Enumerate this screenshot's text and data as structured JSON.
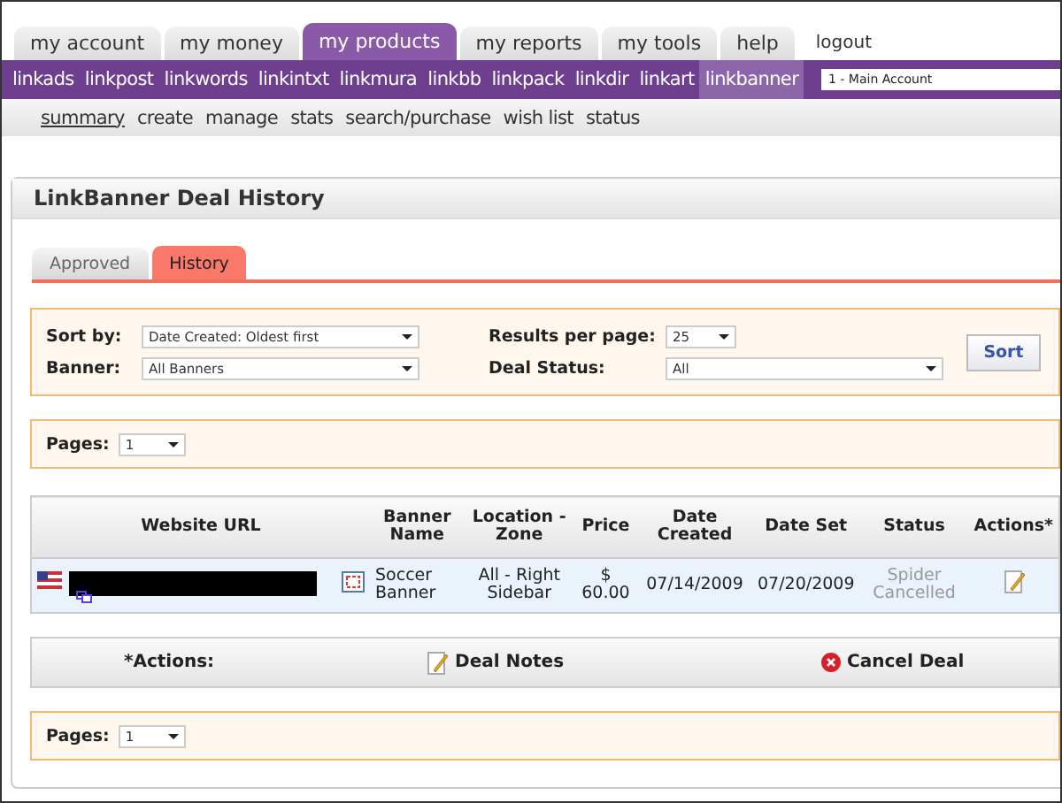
{
  "main_tabs": [
    {
      "label": "my account",
      "selected": false
    },
    {
      "label": "my money",
      "selected": false
    },
    {
      "label": "my products",
      "selected": true
    },
    {
      "label": "my reports",
      "selected": false
    },
    {
      "label": "my tools",
      "selected": false
    },
    {
      "label": "help",
      "selected": false
    }
  ],
  "logout": "logout",
  "product_nav": [
    {
      "label": "linkads",
      "selected": false
    },
    {
      "label": "linkpost",
      "selected": false
    },
    {
      "label": "linkwords",
      "selected": false
    },
    {
      "label": "linkintxt",
      "selected": false
    },
    {
      "label": "linkmura",
      "selected": false
    },
    {
      "label": "linkbb",
      "selected": false
    },
    {
      "label": "linkpack",
      "selected": false
    },
    {
      "label": "linkdir",
      "selected": false
    },
    {
      "label": "linkart",
      "selected": false
    },
    {
      "label": "linkbanner",
      "selected": true
    }
  ],
  "account_select": {
    "value": "1 - Main Account"
  },
  "sub_nav": [
    {
      "label": "summary",
      "selected": true
    },
    {
      "label": "create",
      "selected": false
    },
    {
      "label": "manage",
      "selected": false
    },
    {
      "label": "stats",
      "selected": false
    },
    {
      "label": "search/purchase",
      "selected": false
    },
    {
      "label": "wish list",
      "selected": false
    },
    {
      "label": "status",
      "selected": false
    }
  ],
  "panel": {
    "title": "LinkBanner Deal History",
    "tabs": [
      {
        "label": "Approved",
        "selected": false
      },
      {
        "label": "History",
        "selected": true
      }
    ],
    "filters": {
      "sort_by": {
        "label": "Sort by:",
        "value": "Date Created: Oldest first"
      },
      "results_per_page": {
        "label": "Results per page:",
        "value": "25"
      },
      "banner": {
        "label": "Banner:",
        "value": "All Banners"
      },
      "deal_status": {
        "label": "Deal Status:",
        "value": "All"
      },
      "sort_button": "Sort"
    },
    "pages_top": {
      "label": "Pages:",
      "value": "1"
    },
    "table": {
      "columns": [
        "Website URL",
        "Banner Name",
        "Location - Zone",
        "Price",
        "Date Created",
        "Date Set",
        "Status",
        "Actions*"
      ],
      "rows": [
        {
          "banner_name": "Soccer Banner",
          "location_zone": "All - Right Sidebar",
          "price": "$ 60.00",
          "date_created": "07/14/2009",
          "date_set": "07/20/2009",
          "status": "Spider Cancelled",
          "cancelled": true
        }
      ]
    },
    "actions_legend": {
      "label": "*Actions:",
      "items": [
        {
          "kind": "notes",
          "label": "Deal Notes"
        },
        {
          "kind": "cancel",
          "label": "Cancel Deal"
        }
      ]
    },
    "pages_bottom": {
      "label": "Pages:",
      "value": "1"
    }
  }
}
